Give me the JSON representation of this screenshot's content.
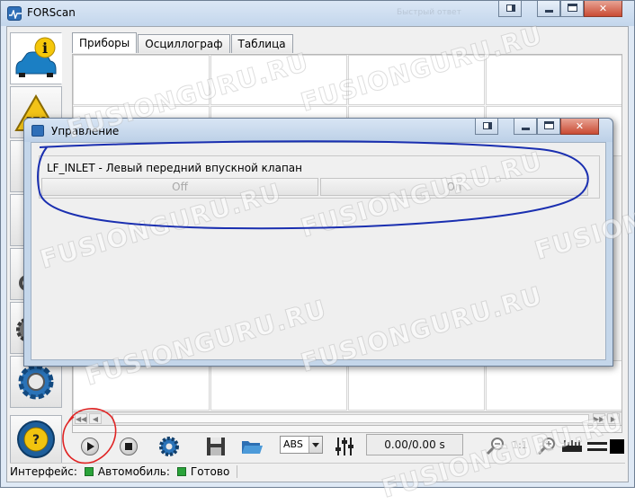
{
  "window": {
    "title": "FORScan",
    "title_hint": "Быстрый ответ"
  },
  "tabs": [
    {
      "label": "Приборы",
      "active": true
    },
    {
      "label": "Осциллограф",
      "active": false
    },
    {
      "label": "Таблица",
      "active": false
    }
  ],
  "sidebar": {
    "items": [
      {
        "icon": "car-info-icon"
      },
      {
        "icon": "dtc-warning-icon"
      },
      {
        "icon": "module-icon"
      },
      {
        "icon": "module-icon"
      },
      {
        "icon": "wrench-icon"
      },
      {
        "icon": "gear-icon"
      },
      {
        "icon": "settings-gear-icon"
      },
      {
        "icon": "steering-help-icon"
      }
    ]
  },
  "dialog": {
    "title": "Управление",
    "control": {
      "label": "LF_INLET - Левый передний впускной клапан",
      "off_label": "Off",
      "on_label": "On"
    }
  },
  "toolbar": {
    "protocol_value": "ABS",
    "time_display": "0.00/0.00 s",
    "zoom_ratio": "1:1"
  },
  "status": {
    "interface_label": "Интерфейс:",
    "vehicle_label": "Автомобиль:",
    "ready_label": "Готово"
  },
  "colors": {
    "status_ok": "#2aa33a",
    "annotation_blue": "#1a2fb0",
    "annotation_red": "#e02424"
  },
  "watermark_text": "FUSIONGURU.RU"
}
